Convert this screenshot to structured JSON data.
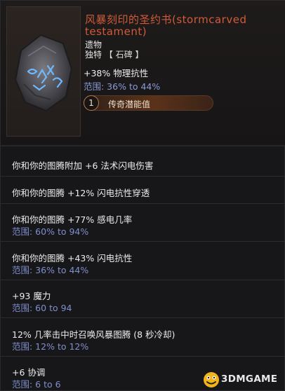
{
  "item": {
    "title_line1": "风暴刻印的圣约书(stormcarved",
    "title_line2": "testament)",
    "category": "遗物",
    "rarity": "独特",
    "subtype": "【 石碑 】",
    "stat_value": "+38% 物理抗性",
    "stat_range": "范围: 36% to 44%",
    "legend_level": "1",
    "legend_label": "传奇潜能值"
  },
  "affixes": [
    {
      "text": "你和你的图腾附加 +6 法术闪电伤害",
      "range": ""
    },
    {
      "text": "你和你的图腾 +12% 闪电抗性穿透",
      "range": ""
    },
    {
      "text": "你和你的图腾 +77% 感电几率",
      "range": "范围: 60% to 94%"
    },
    {
      "text": "你和你的图腾 +43% 闪电抗性",
      "range": "范围: 36% to 44%"
    },
    {
      "text": "+93 魔力",
      "range": "范围: 60 to 94"
    },
    {
      "text": "12% 几率击中时召唤风暴图腾 (8 秒冷却)",
      "range": "范围: 12% to 12%"
    },
    {
      "text": "+6 协调",
      "range": "范围: 6 to 6"
    }
  ],
  "watermark": {
    "text": "3DMGAME"
  },
  "icons": {
    "item": "stormcarved-stone-tablet-icon",
    "watermark": "3dm-logo-icon"
  },
  "colors": {
    "title": "#d25a3a",
    "range": "#8a9bd6",
    "background": "#17171a"
  }
}
